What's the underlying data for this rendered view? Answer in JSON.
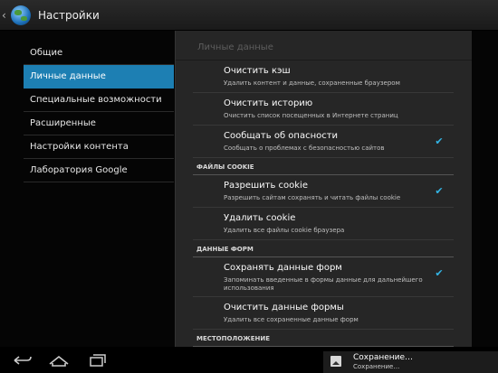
{
  "app": {
    "title": "Настройки"
  },
  "sidebar": {
    "items": [
      {
        "label": "Общие"
      },
      {
        "label": "Личные данные",
        "active": true
      },
      {
        "label": "Специальные возможности"
      },
      {
        "label": "Расширенные"
      },
      {
        "label": "Настройки контента"
      },
      {
        "label": "Лаборатория Google"
      }
    ]
  },
  "panel": {
    "title": "Личные данные",
    "rows": [
      {
        "title": "Очистить кэш",
        "sub": "Удалить контент и данные, сохраненные браузером"
      },
      {
        "title": "Очистить историю",
        "sub": "Очистить список посещенных в Интернете страниц"
      },
      {
        "title": "Сообщать об опасности",
        "sub": "Сообщать о проблемах с безопасностью сайтов",
        "checked": true
      }
    ],
    "section_cookie": "ФАЙЛЫ COOKIE",
    "cookie_rows": [
      {
        "title": "Разрешить cookie",
        "sub": "Разрешить сайтам сохранять и читать файлы cookie",
        "checked": true
      },
      {
        "title": "Удалить cookie",
        "sub": "Удалить все файлы cookie браузера"
      }
    ],
    "section_forms": "ДАННЫЕ ФОРМ",
    "form_rows": [
      {
        "title": "Сохранять данные форм",
        "sub": "Запоминать введенные в формы данные для дальнейшего использования",
        "checked": true
      },
      {
        "title": "Очистить данные формы",
        "sub": "Удалить все сохраненные данные форм"
      }
    ],
    "section_location": "МЕСТОПОЛОЖЕНИЕ"
  },
  "notification": {
    "title": "Сохранение…",
    "sub": "Сохранение…"
  },
  "colors": {
    "accent": "#1d7fb3",
    "check": "#33b5e5"
  },
  "icons": {
    "back": "back-icon",
    "home": "home-icon",
    "recents": "recents-icon",
    "image": "image-icon",
    "app": "globe-icon"
  }
}
